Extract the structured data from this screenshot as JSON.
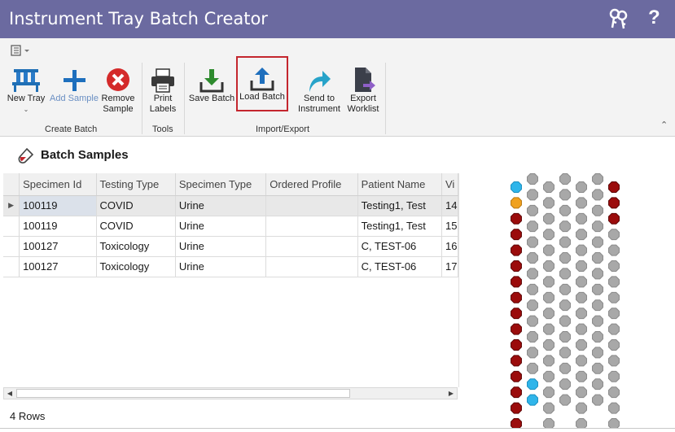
{
  "window": {
    "title": "Instrument Tray Batch Creator",
    "help": "?"
  },
  "ribbon": {
    "buttons": {
      "new_tray": "New Tray",
      "add_sample": "Add Sample",
      "remove_sample_line1": "Remove",
      "remove_sample_line2": "Sample",
      "print_labels_line1": "Print",
      "print_labels_line2": "Labels",
      "save_batch": "Save Batch",
      "load_batch": "Load Batch",
      "send_instrument_line1": "Send to",
      "send_instrument_line2": "Instrument",
      "export_worklist_line1": "Export",
      "export_worklist_line2": "Worklist"
    },
    "groups": {
      "create_batch": "Create Batch",
      "tools": "Tools",
      "import_export": "Import/Export"
    }
  },
  "section": {
    "title": "Batch Samples"
  },
  "grid": {
    "columns": [
      "Specimen Id",
      "Testing Type",
      "Specimen Type",
      "Ordered Profile",
      "Patient Name",
      "Vi"
    ],
    "rows": [
      [
        "100119",
        "COVID",
        "Urine",
        "",
        "Testing1, Test",
        "14"
      ],
      [
        "100119",
        "COVID",
        "Urine",
        "",
        "Testing1, Test",
        "15"
      ],
      [
        "100127",
        "Toxicology",
        "Urine",
        "",
        "C, TEST-06",
        "16"
      ],
      [
        "100127",
        "Toxicology",
        "Urine",
        "",
        "C, TEST-06",
        "17"
      ]
    ],
    "selected_row": 0
  },
  "status": {
    "row_count": "4 Rows"
  },
  "tray": {
    "colors": {
      "gray": "#a8a8a8",
      "red": "#9b0c0c",
      "blue": "#2fb5ea",
      "orange": "#f0a11e"
    },
    "columns": [
      [
        "blue",
        "orange",
        "red",
        "red",
        "red",
        "red",
        "red",
        "red",
        "red",
        "red",
        "red",
        "red",
        "red",
        "red",
        "red",
        "red"
      ],
      [
        "gray",
        "gray",
        "gray",
        "gray",
        "gray",
        "gray",
        "gray",
        "gray",
        "gray",
        "gray",
        "gray",
        "gray",
        "gray",
        "blue",
        "blue"
      ],
      [
        "gray",
        "gray",
        "gray",
        "gray",
        "gray",
        "gray",
        "gray",
        "gray",
        "gray",
        "gray",
        "gray",
        "gray",
        "gray",
        "gray",
        "gray",
        "gray"
      ],
      [
        "gray",
        "gray",
        "gray",
        "gray",
        "gray",
        "gray",
        "gray",
        "gray",
        "gray",
        "gray",
        "gray",
        "gray",
        "gray",
        "gray",
        "gray"
      ],
      [
        "gray",
        "gray",
        "gray",
        "gray",
        "gray",
        "gray",
        "gray",
        "gray",
        "gray",
        "gray",
        "gray",
        "gray",
        "gray",
        "gray",
        "gray",
        "gray"
      ],
      [
        "gray",
        "gray",
        "gray",
        "gray",
        "gray",
        "gray",
        "gray",
        "gray",
        "gray",
        "gray",
        "gray",
        "gray",
        "gray",
        "gray",
        "gray"
      ],
      [
        "red",
        "red",
        "red",
        "gray",
        "gray",
        "gray",
        "gray",
        "gray",
        "gray",
        "gray",
        "gray",
        "gray",
        "gray",
        "gray",
        "gray",
        "gray"
      ]
    ]
  }
}
